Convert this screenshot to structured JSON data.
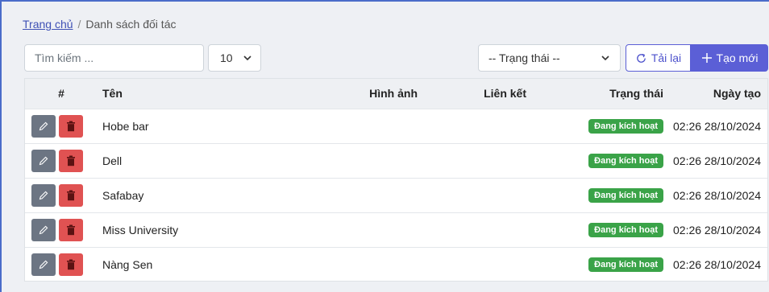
{
  "breadcrumb": {
    "home": "Trang chủ",
    "separator": "/",
    "current": "Danh sách đối tác"
  },
  "toolbar": {
    "search_placeholder": "Tìm kiếm ...",
    "page_size": "10",
    "status_filter": "-- Trạng thái --",
    "reload_label": "Tải lại",
    "create_label": "Tạo mới"
  },
  "table": {
    "headers": {
      "index": "#",
      "name": "Tên",
      "image": "Hình ảnh",
      "link": "Liên kết",
      "status": "Trạng thái",
      "created": "Ngày tạo"
    },
    "rows": [
      {
        "name": "Hobe bar",
        "image": "",
        "link": "",
        "status": "Đang kích hoạt",
        "created": "02:26 28/10/2024"
      },
      {
        "name": "Dell",
        "image": "",
        "link": "",
        "status": "Đang kích hoạt",
        "created": "02:26 28/10/2024"
      },
      {
        "name": "Safabay",
        "image": "",
        "link": "",
        "status": "Đang kích hoạt",
        "created": "02:26 28/10/2024"
      },
      {
        "name": "Miss University",
        "image": "",
        "link": "",
        "status": "Đang kích hoạt",
        "created": "02:26 28/10/2024"
      },
      {
        "name": "Nàng Sen",
        "image": "",
        "link": "",
        "status": "Đang kích hoạt",
        "created": "02:26 28/10/2024"
      }
    ]
  },
  "colors": {
    "accent": "#5b5fd6",
    "status_active": "#3aa348",
    "edit_button": "#6c7583",
    "delete_button": "#e05252"
  },
  "icons": {
    "edit": "pencil-icon",
    "delete": "trash-icon",
    "reload": "refresh-icon",
    "create": "plus-icon",
    "dropdown": "chevron-down-icon"
  }
}
